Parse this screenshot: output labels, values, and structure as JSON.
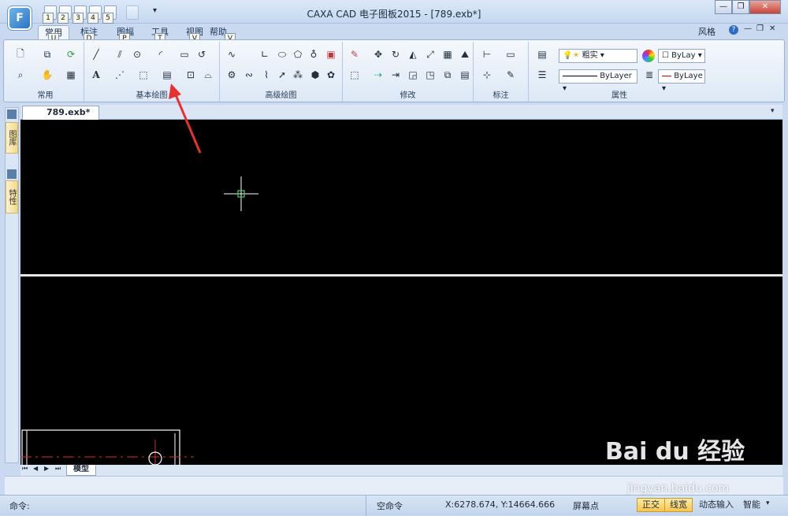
{
  "title": {
    "window_title": "CAXA CAD 电子图板2015 - [789.exb*]",
    "app_logo": "F"
  },
  "qat": {
    "badges": [
      "1",
      "2",
      "3",
      "4",
      "5"
    ],
    "more": "▾"
  },
  "window_controls": {
    "minimize": "—",
    "restore": "❐",
    "close": "✕"
  },
  "ribbon_tabs": [
    {
      "label": "常用",
      "key": "U"
    },
    {
      "label": "标注",
      "key": "D"
    },
    {
      "label": "图幅",
      "key": "P"
    },
    {
      "label": "工具",
      "key": "T"
    },
    {
      "label": "视图",
      "key": "V"
    },
    {
      "label": "帮助",
      "key": "V"
    }
  ],
  "style_menu": {
    "label": "风格"
  },
  "groups": [
    {
      "label": "常用"
    },
    {
      "label": "基本绘图"
    },
    {
      "label": "高级绘图"
    },
    {
      "label": "修改"
    },
    {
      "label": "标注"
    },
    {
      "label": "属性"
    }
  ],
  "properties": {
    "layer_combo": "粗实",
    "color_combo": "ByLay",
    "linetype_combo": "ByLayer",
    "lineweight_combo": "ByLaye"
  },
  "document": {
    "tab_label": "789.exb*",
    "close": "×",
    "overflow": "▾"
  },
  "side_panel": {
    "tab1": "图库",
    "tab2": "特性"
  },
  "layout_tabs": {
    "model": "模型",
    "nav": [
      "⏮",
      "◀",
      "▶",
      "⏭"
    ]
  },
  "command": {
    "prompt": "命令:"
  },
  "status": {
    "command_state": "空命令",
    "coordinates": "X:6278.674, Y:14664.666",
    "snap_mode": "屏幕点",
    "ortho": "正交",
    "lineweight": "线宽",
    "dynamic_input": "动态输入",
    "smart": "智能"
  },
  "watermark": {
    "brand": "Bai du 经验",
    "url": "jingyan.baidu.com"
  },
  "colors": {
    "canvas": "#000000",
    "accent_arrow": "#e8312f",
    "cursor": "#3fd16a"
  },
  "annotation": {
    "arrow_points_to": "基本绘图"
  }
}
